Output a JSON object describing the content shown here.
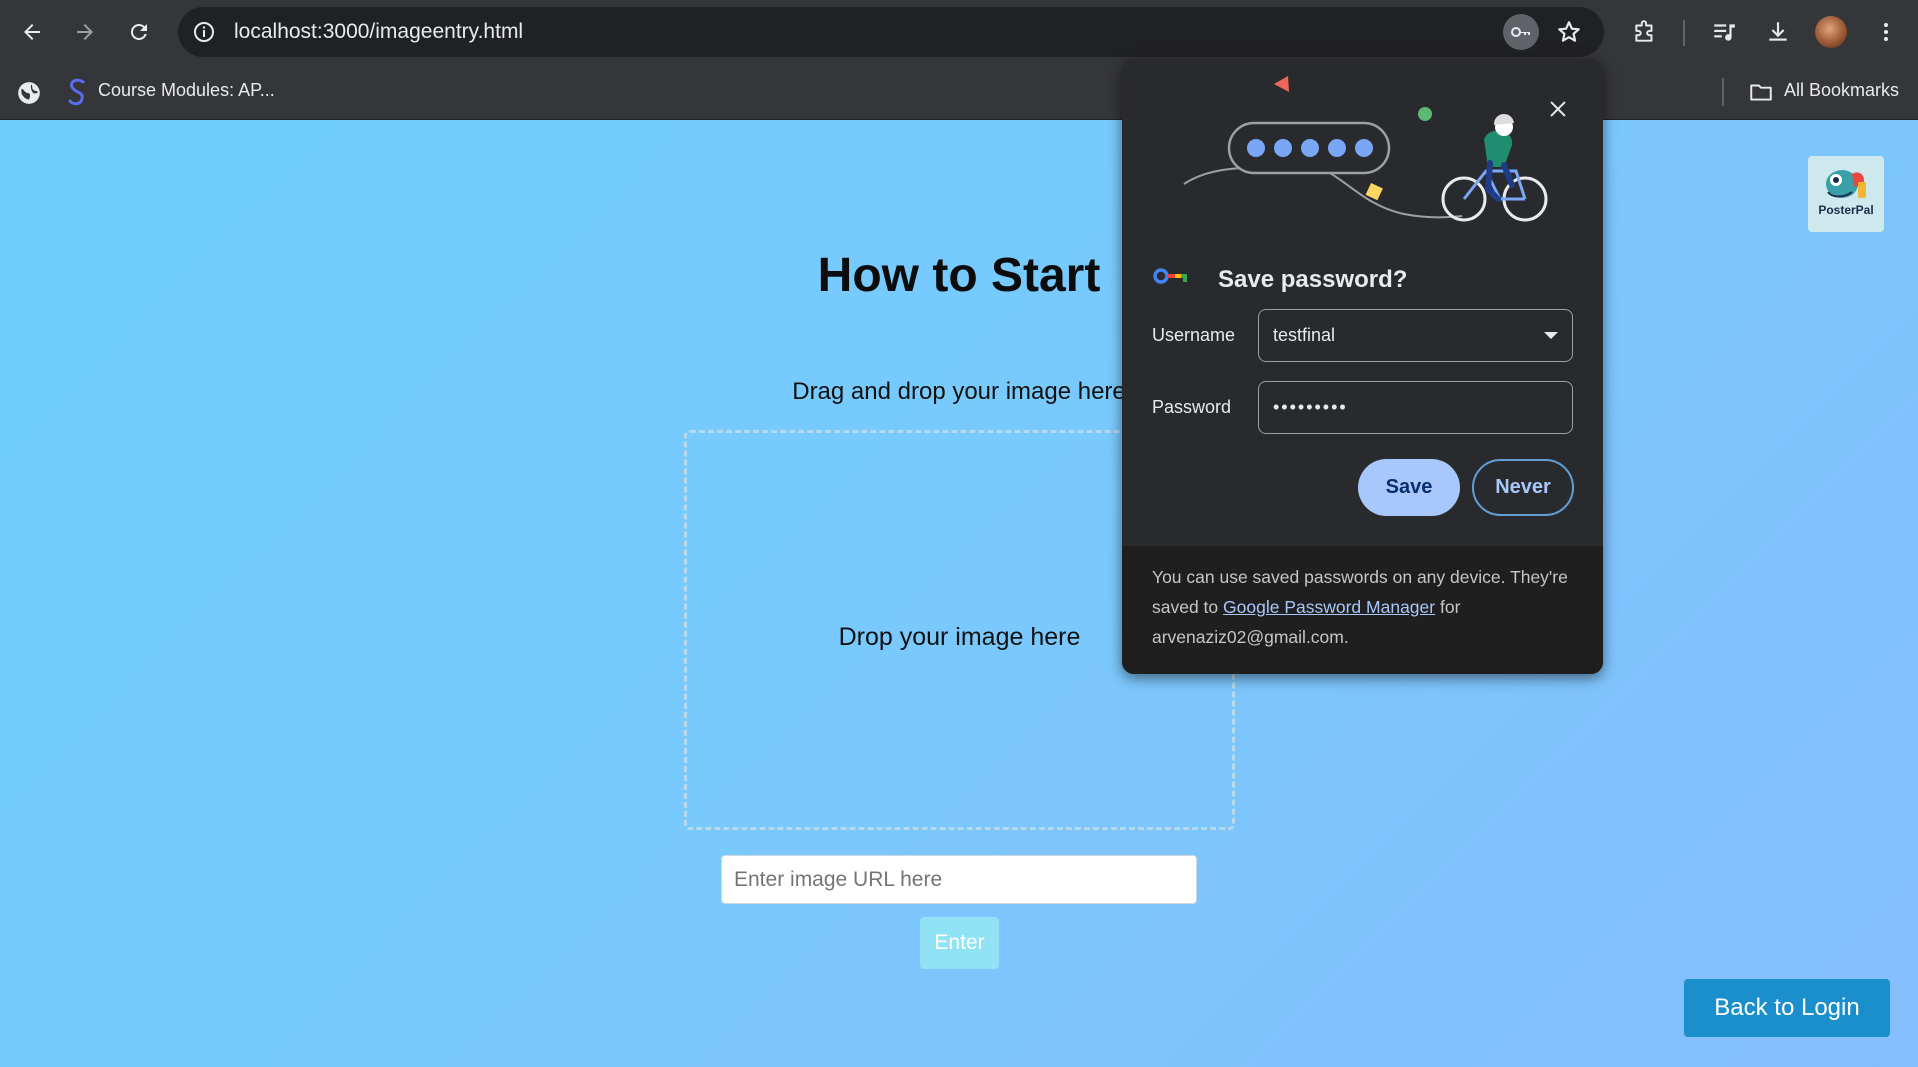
{
  "browser": {
    "url": "localhost:3000/imageentry.html",
    "bookmark_tab_label": "Course Modules: AP...",
    "all_bookmarks_label": "All Bookmarks"
  },
  "page": {
    "title": "How to Start",
    "drag_text": "Drag and drop your image here",
    "dropzone_text": "Drop your image here",
    "url_placeholder": "Enter image URL here",
    "enter_label": "Enter",
    "back_label": "Back to Login",
    "logo_text": "PosterPal"
  },
  "dialog": {
    "title": "Save password?",
    "username_label": "Username",
    "username_value": "testfinal",
    "password_label": "Password",
    "password_value": "•••••••••",
    "save_label": "Save",
    "never_label": "Never",
    "footer_text_1": "You can use saved passwords on any device. They're saved to",
    "footer_link": "Google Password Manager",
    "footer_text_2": "for arvenaziz02@gmail.com."
  },
  "colors": {
    "page_gradient_start": "#6ecdfc",
    "page_gradient_end": "#85bdfd",
    "back_button": "#1a8fcb",
    "enter_button": "#8fe3f4",
    "dialog_bg": "#292a2d",
    "save_button": "#a8c7fa"
  }
}
